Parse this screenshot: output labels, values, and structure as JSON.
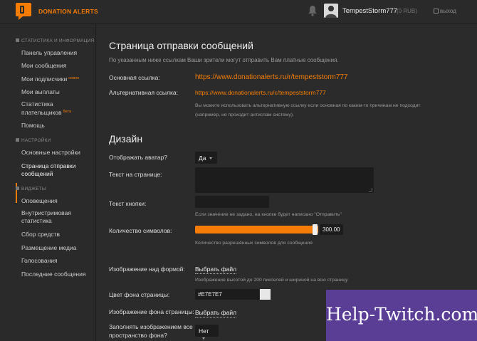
{
  "header": {
    "brand": "DONATION ALERTS",
    "username": "TempestStorm777",
    "balance": "(0 RUB)",
    "logout_label": "выход",
    "accent_color": "#f57d07"
  },
  "sidebar": {
    "sections": [
      {
        "title": "СТАТИСТИКА И ИНФОРМАЦИЯ",
        "items": [
          {
            "label": "Панель управления"
          },
          {
            "label": "Мои сообщения"
          },
          {
            "label": "Мои подписчики",
            "badge": "новое"
          },
          {
            "label": "Мои выплаты"
          },
          {
            "label": "Статистика плательщиков",
            "badge": "бета"
          },
          {
            "label": "Помощь"
          }
        ]
      },
      {
        "title": "НАСТРОЙКИ",
        "items": [
          {
            "label": "Основные настройки"
          },
          {
            "label": "Страница отправки сообщений",
            "active": true
          }
        ]
      },
      {
        "title": "ВИДЖЕТЫ",
        "items": [
          {
            "label": "Оповещения"
          },
          {
            "label": "Внутристримовая статистика"
          },
          {
            "label": "Сбор средств"
          },
          {
            "label": "Размещение медиа"
          },
          {
            "label": "Голосования"
          },
          {
            "label": "Последние сообщения"
          }
        ]
      }
    ]
  },
  "main": {
    "title": "Страница отправки сообщений",
    "description": "По указанным ниже ссылкам Ваши зрители могут отправить Вам платные сообщения.",
    "main_link_label": "Основная ссылка:",
    "main_link": "https://www.donationalerts.ru/r/tempeststorm777",
    "alt_link_label": "Альтернативная ссылка:",
    "alt_link": "https://www.donationalerts.ru/c/tempeststorm777",
    "alt_note_line1": "Вы можете использовать альтернативную ссылку если основная по каким-то причинам не подходит",
    "alt_note_line2": "(например, не проходит антиспам систему).",
    "design_title": "Дизайн",
    "show_avatar_label": "Отображать аватар?",
    "show_avatar_value": "Да",
    "page_text_label": "Текст на странице:",
    "page_text_value": "",
    "button_text_label": "Текст кнопки:",
    "button_text_value": "",
    "button_text_note": "Если значение не задано, на кнопке будет написано \"Отправить\"",
    "char_count_label": "Количество символов:",
    "char_count_value": "300.00",
    "char_count_fill": 1.0,
    "char_count_note": "Количество разрешённых символов для сообщения",
    "header_image_label": "Изображение над формой:",
    "choose_file_label": "Выбрать файл",
    "header_image_note": "Изображение высотой до 200 пикселей и шириной на всю страницу",
    "bg_color_label": "Цвет фона страницы:",
    "bg_color_value": "#E7E7E7",
    "bg_image_label": "Изображение фона страницы:",
    "fill_label": "Заполнять изображением все пространство фона?",
    "fill_value": "Нет"
  },
  "watermark": {
    "text": "Help-Twitch.com"
  }
}
